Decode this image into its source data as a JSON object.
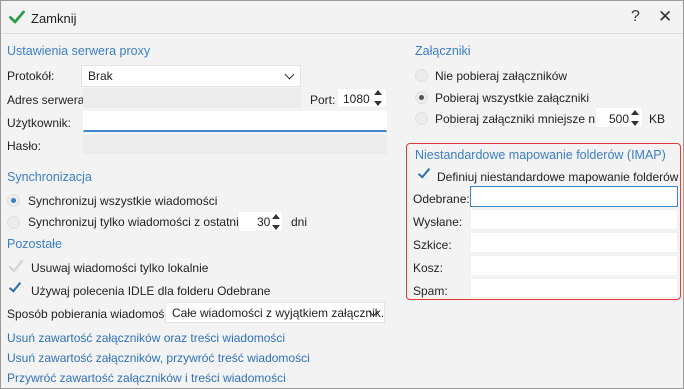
{
  "titlebar": {
    "close_label": "Zamknij",
    "help_glyph": "?",
    "close_glyph": "✕"
  },
  "proxy": {
    "heading": "Ustawienia serwera proxy",
    "protocol_label": "Protokół:",
    "protocol_value": "Brak",
    "server_label": "Adres serwera:",
    "port_label": "Port:",
    "port_value": "1080",
    "user_label": "Użytkownik:",
    "password_label": "Hasło:"
  },
  "sync": {
    "heading": "Synchronizacja",
    "option_all": "Synchronizuj wszystkie wiadomości",
    "option_recent": "Synchronizuj tylko wiadomości z ostatnich",
    "days_value": "30",
    "days_unit": "dni"
  },
  "other": {
    "heading": "Pozostałe",
    "delete_local": "Usuwaj wiadomości tylko lokalnie",
    "use_idle": "Używaj polecenia IDLE dla folderu Odebrane",
    "download_label": "Sposób pobierania wiadomości:",
    "download_value": "Całe wiadomości z wyjątkiem załącznik...",
    "link_remove_all": "Usuń zawartość załączników oraz treści wiadomości",
    "link_remove_attach_restore": "Usuń zawartość załączników, przywróć treść wiadomości",
    "link_restore_all": "Przywróć zawartość załączników i treści wiadomości"
  },
  "attachments": {
    "heading": "Załączniki",
    "option_none": "Nie pobieraj załączników",
    "option_all": "Pobieraj wszystkie załączniki",
    "option_smaller": "Pobieraj załączniki mniejsze niż:",
    "size_value": "500",
    "size_unit": "KB"
  },
  "imap": {
    "heading": "Niestandardowe mapowanie folderów (IMAP)",
    "define_label": "Definiuj niestandardowe mapowanie folderów",
    "inbox_label": "Odebrane:",
    "sent_label": "Wysłane:",
    "drafts_label": "Szkice:",
    "trash_label": "Kosz:",
    "spam_label": "Spam:"
  },
  "colors": {
    "accent": "#3b7fc4",
    "highlight_box": "#e23a3a",
    "check_green": "#2e9b4a"
  }
}
